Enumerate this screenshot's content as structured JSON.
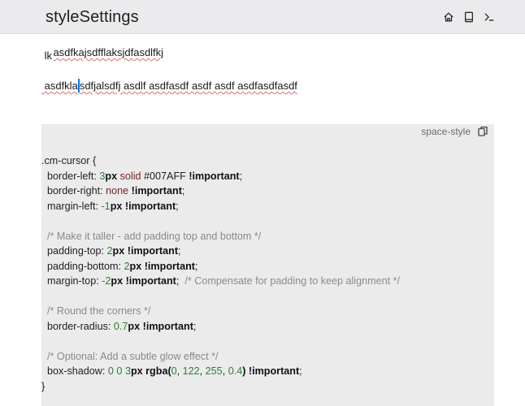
{
  "app": {
    "title": "styleSettings"
  },
  "toolbar_icons": [
    "home-icon",
    "book-icon",
    "terminal-icon"
  ],
  "editor": {
    "line1": "asdfkajsdfflaksjdfasdlfkj",
    "line2": " lk",
    "line3_before_caret": " asdfkla",
    "line3_after_caret": "sdfjalsdfj asdlf asdfasdf asdf asdf asdfasdfasdf"
  },
  "codeblock": {
    "language": "space-style",
    "lines": [
      ".cm-cursor {",
      "  border-left: 3px solid #007AFF !important;",
      "  border-right: none !important;",
      "  margin-left: -1px !important;",
      "",
      "  /* Make it taller - add padding top and bottom */",
      "  padding-top: 2px !important;",
      "  padding-bottom: 2px !important;",
      "  margin-top: -2px !important;  /* Compensate for padding to keep alignment */",
      "",
      "  /* Round the corners */",
      "  border-radius: 0.7px !important;",
      "",
      "  /* Optional: Add a subtle glow effect */",
      "  box-shadow: 0 0 3px rgba(0, 122, 255, 0.4) !important;",
      "}"
    ]
  },
  "colors": {
    "caret": "#007AFF",
    "topbar": "#ebebed",
    "code_bg": "#ebebeb",
    "number": "#2e7d32",
    "keyword_value": "#7b1e1e",
    "comment": "#8a8a8a"
  }
}
